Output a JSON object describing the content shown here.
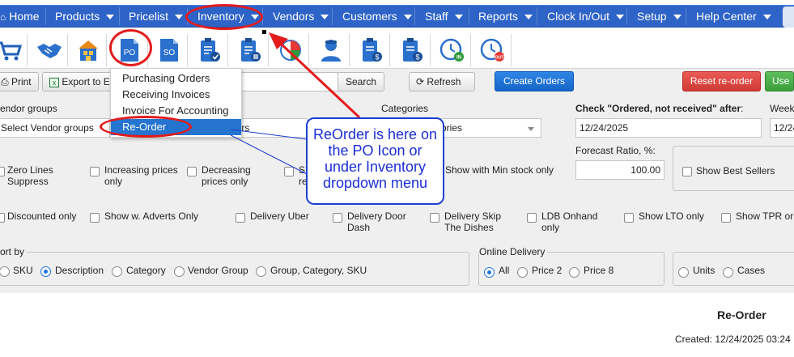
{
  "nav": {
    "items": [
      {
        "label": "Home"
      },
      {
        "label": "Products"
      },
      {
        "label": "Pricelist"
      },
      {
        "label": "Inventory"
      },
      {
        "label": "Vendors"
      },
      {
        "label": "Customers"
      },
      {
        "label": "Staff"
      },
      {
        "label": "Reports"
      },
      {
        "label": "Clock In/Out"
      },
      {
        "label": "Setup"
      },
      {
        "label": "Help Center"
      }
    ],
    "bar_color": "#2e64c7"
  },
  "toolbar_icons": [
    "cart-icon",
    "handshake-icon",
    "store-icon",
    "po-icon",
    "so-icon",
    "clipboard-check-icon",
    "clipboard-list-icon",
    "pie-chart-icon",
    "user-icon",
    "clipboard-dollar-icon",
    "clipboard-dollar-icon",
    "clock-in-icon",
    "clock-out-icon"
  ],
  "toolbar_icon_text": {
    "po": "PO",
    "so": "SO",
    "in": "IN",
    "out": "OUT"
  },
  "actions": {
    "print": "Print",
    "export": "Export to E",
    "search": "Search",
    "refresh": "Refresh",
    "create_orders": "Create Orders",
    "reset_reorder": "Reset re-order",
    "use": "Use"
  },
  "inventory_menu": {
    "items": [
      {
        "label": "Purchasing Orders"
      },
      {
        "label": "Receiving Invoices"
      },
      {
        "label": "Invoice For Accounting"
      },
      {
        "label": "Re-Order"
      }
    ],
    "selected_index": 3
  },
  "filters": {
    "vendor_groups_label": "endor groups",
    "vendor_groups_value": "Select Vendor groups",
    "vendors_value": "dors",
    "categories_label": "Categories",
    "categories_value": "ories",
    "check_label": "Check \"Ordered, not received\" after",
    "check_label_suffix": ":",
    "check_date": "12/24/2025",
    "weeks_label": "Week",
    "weeks_date": "12/24",
    "forecast_label": "Forecast Ratio, %:",
    "forecast_value": "100.00",
    "best_sellers": "Show Best Sellers",
    "row1": {
      "zero_lines": "Zero Lines Suppress",
      "increasing": "Increasing prices only",
      "decreasing": "Decreasing prices only",
      "s_partial": "S",
      "r_partial": "re",
      "min_stock": "Show with Min stock only"
    },
    "row2": [
      "Discounted only",
      "Show w. Adverts Only",
      "Delivery Uber",
      "Delivery Door Dash",
      "Delivery Skip The Dishes",
      "LDB Onhand only",
      "Show LTO only",
      "Show TPR or"
    ],
    "sort_by_label": "ort by",
    "sort_options": [
      "SKU",
      "Description",
      "Category",
      "Vendor Group",
      "Group, Category, SKU"
    ],
    "sort_selected": 1,
    "online_delivery_label": "Online Delivery",
    "online_options": [
      "All",
      "Price 2",
      "Price 8"
    ],
    "online_selected": 0,
    "unit_options": [
      "Units",
      "Cases"
    ]
  },
  "annotation": {
    "callout": "ReOrder is here on the PO Icon or under Inventory dropdown menu",
    "color": "#1a2fd6",
    "ring_color": "#e31b1b"
  },
  "report": {
    "title": "Re-Order",
    "created": "Created: 12/24/2025 03:24"
  }
}
